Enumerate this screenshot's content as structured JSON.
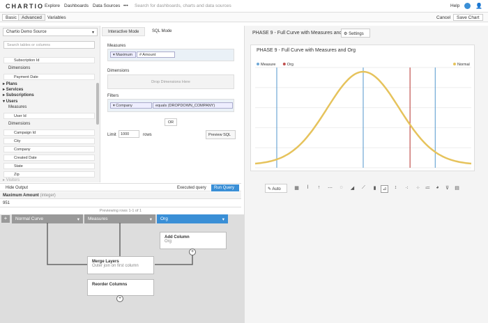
{
  "nav": {
    "logo": "CHARTIO",
    "explore": "Explore",
    "dashboards": "Dashboards",
    "data_sources": "Data Sources",
    "more": "•••",
    "search_placeholder": "Search for dashboards, charts and data sources",
    "help": "Help"
  },
  "sub": {
    "basic": "Basic",
    "advanced": "Advanced",
    "variables": "Variables",
    "cancel": "Cancel",
    "save": "Save Chart"
  },
  "left": {
    "source": "Chartio Demo Source",
    "search": "Search tables or columns",
    "field_top": "Subscription Id",
    "dimensions": "Dimensions",
    "payment_date": "Payment Date",
    "plans": "Plans",
    "services": "Services",
    "subscriptions": "Subscriptions",
    "users": "Users",
    "measures": "Measures",
    "user_id": "User Id",
    "dims2": "Dimensions",
    "fields": [
      "Campaign Id",
      "City",
      "Company",
      "Created Date",
      "State",
      "Zip"
    ],
    "visitors": "Visitors"
  },
  "mid": {
    "tab_interactive": "Interactive Mode",
    "tab_sql": "SQL Mode",
    "measures_label": "Measures",
    "pill_max": "Maximum",
    "pill_amount": "Amount",
    "dimensions_label": "Dimensions",
    "drop_dims": "Drop Dimensions Here",
    "filters_label": "Filters",
    "filter_col": "Company",
    "filter_op": "equals (DROPDOWN_COMPANY)",
    "or": "OR",
    "limit_label": "Limit",
    "limit_value": "1000",
    "rows": "rows",
    "preview": "Preview SQL"
  },
  "output": {
    "hide": "Hide Output",
    "executed": "Executed query",
    "run": "Run Query",
    "col_name": "Maximum Amount",
    "col_type": "(integer)",
    "value": "951",
    "previewing": "Previewing rows 1-1 of 1"
  },
  "pipeline": {
    "col1": "Normal Curve",
    "col2": "Measures",
    "col3": "Org",
    "add_column": "Add Column",
    "add_column_sub": "Org",
    "merge": "Merge Layers",
    "merge_sub": "Outer join on first column",
    "reorder": "Reorder Columns"
  },
  "right": {
    "title": "PHASE 9 - Full Curve with Measures and",
    "settings": "Settings",
    "chart_title": "PHASE 9 - Full Curve with Measures and Org",
    "auto": "Auto"
  },
  "chart_data": {
    "type": "line",
    "legend_left": [
      {
        "name": "Measure",
        "color": "#6fa8d6"
      },
      {
        "name": "Org",
        "color": "#c0504d"
      }
    ],
    "legend_right": [
      {
        "name": "Normal",
        "color": "#e6c35c"
      }
    ],
    "curve": "normal",
    "mean": 0,
    "sd": 1,
    "xlim": [
      -3,
      3
    ],
    "vlines": [
      {
        "x": -2.4,
        "color": "#6fa8d6"
      },
      {
        "x": 0,
        "color": "#6fa8d6"
      },
      {
        "x": 1.3,
        "color": "#c0504d"
      },
      {
        "x": 2.0,
        "color": "#6fa8d6"
      }
    ]
  },
  "colors": {
    "accent": "#3a8fd6",
    "header_grey": "#999",
    "curve": "#e6c35c"
  }
}
